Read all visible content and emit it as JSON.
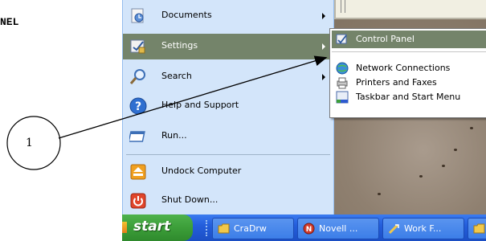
{
  "document": {
    "heading": "NEL"
  },
  "callout": {
    "number": "1"
  },
  "start_menu": {
    "items": [
      {
        "label": "Documents",
        "icon": "documents-icon",
        "has_submenu": true
      },
      {
        "label": "Settings",
        "icon": "settings-icon",
        "has_submenu": true,
        "highlighted": true
      },
      {
        "label": "Search",
        "icon": "search-icon",
        "has_submenu": true
      },
      {
        "label": "Help and Support",
        "icon": "help-icon",
        "has_submenu": false
      },
      {
        "label": "Run...",
        "icon": "run-icon",
        "has_submenu": false
      },
      {
        "label": "Undock Computer",
        "icon": "undock-icon",
        "has_submenu": false
      },
      {
        "label": "Shut Down...",
        "icon": "shutdown-icon",
        "has_submenu": false
      }
    ]
  },
  "settings_submenu": {
    "items": [
      {
        "label": "Control Panel",
        "icon": "control-panel-icon",
        "highlighted": true
      },
      {
        "label": "Network Connections",
        "icon": "network-connections-icon"
      },
      {
        "label": "Printers and Faxes",
        "icon": "printers-faxes-icon"
      },
      {
        "label": "Taskbar and Start Menu",
        "icon": "taskbar-start-menu-icon"
      }
    ]
  },
  "taskbar": {
    "start_label": "start",
    "tasks": [
      {
        "label": "CraDrw",
        "icon": "folder-icon"
      },
      {
        "label": "Novell ...",
        "icon": "novell-icon"
      },
      {
        "label": "Work F...",
        "icon": "work-folder-icon"
      }
    ]
  },
  "colors": {
    "menu_highlight": "#74846a",
    "taskbar_blue": "#245edc",
    "start_green": "#3c9e39",
    "menu_background": "#d3e5fa"
  }
}
